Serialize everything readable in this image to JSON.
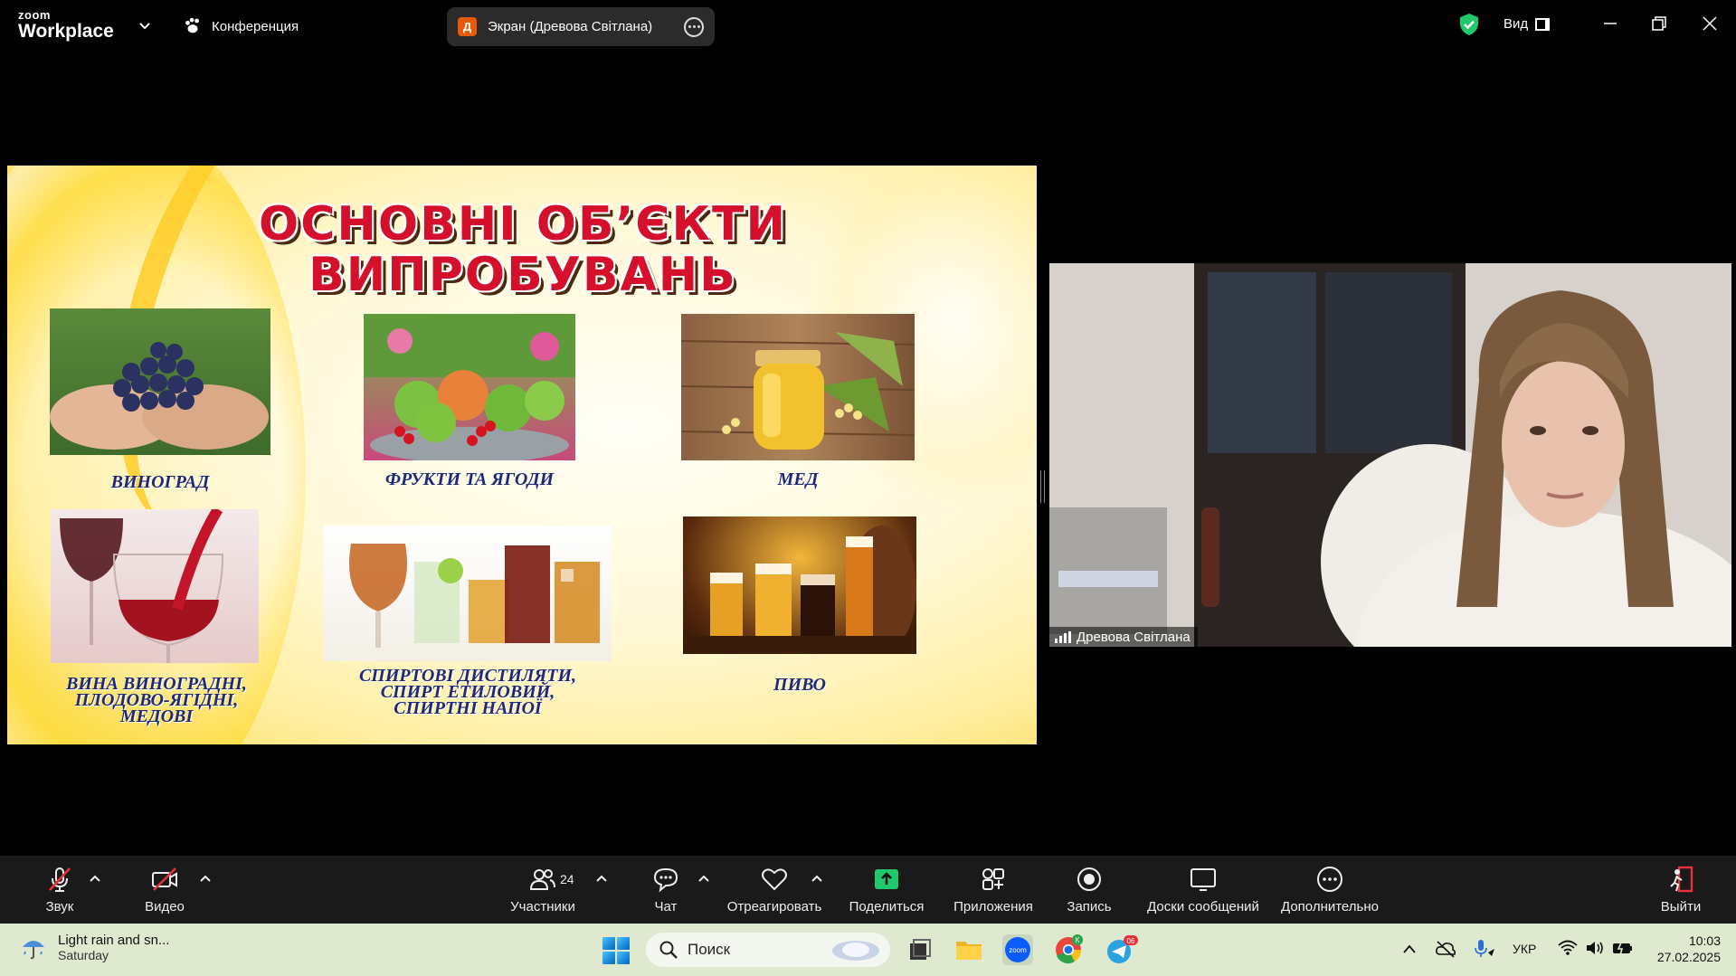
{
  "app": {
    "brand_top": "zoom",
    "brand_bottom": "Workplace",
    "conference_label": "Конференция"
  },
  "share_pill": {
    "avatar_letter": "Д",
    "label": "Экран (Древова Світлана)"
  },
  "view_label": "Вид",
  "slide": {
    "title_line1": "ОСНОВНІ ОБ’ЄКТИ",
    "title_line2": "ВИПРОБУВАНЬ",
    "captions": {
      "grapes": "ВИНОГРАД",
      "fruits": "ФРУКТИ ТА ЯГОДИ",
      "honey": "МЕД",
      "wine_1": "ВИНА ВИНОГРАДНІ,",
      "wine_2": "ПЛОДОВО-ЯГІДНІ,",
      "wine_3": "МЕДОВІ",
      "spirits_1": "СПИРТОВІ ДИСТИЛЯТИ,",
      "spirits_2": "СПИРТ ЕТИЛОВИЙ,",
      "spirits_3": "СПИРТНІ НАПОЇ",
      "beer": "ПИВО"
    }
  },
  "participant": {
    "name": "Древова Світлана"
  },
  "toolbar": {
    "audio": "Звук",
    "video": "Видео",
    "participants": "Участники",
    "participants_count": "24",
    "chat": "Чат",
    "react": "Отреагировать",
    "share": "Поделиться",
    "apps": "Приложения",
    "record": "Запись",
    "whiteboards": "Доски сообщений",
    "more": "Дополнительно",
    "leave": "Выйти"
  },
  "taskbar": {
    "weather_line1": "Light rain and sn...",
    "weather_line2": "Saturday",
    "search_placeholder": "Поиск",
    "telegram_badge": "06",
    "chrome_badge": "K",
    "language": "УКР",
    "time": "10:03",
    "date": "27.02.2025"
  },
  "colors": {
    "accent_green": "#1fc96b",
    "zoom_blue": "#0b5cff",
    "slide_title_red": "#d5102a",
    "caption_blue": "#1e2a78"
  }
}
